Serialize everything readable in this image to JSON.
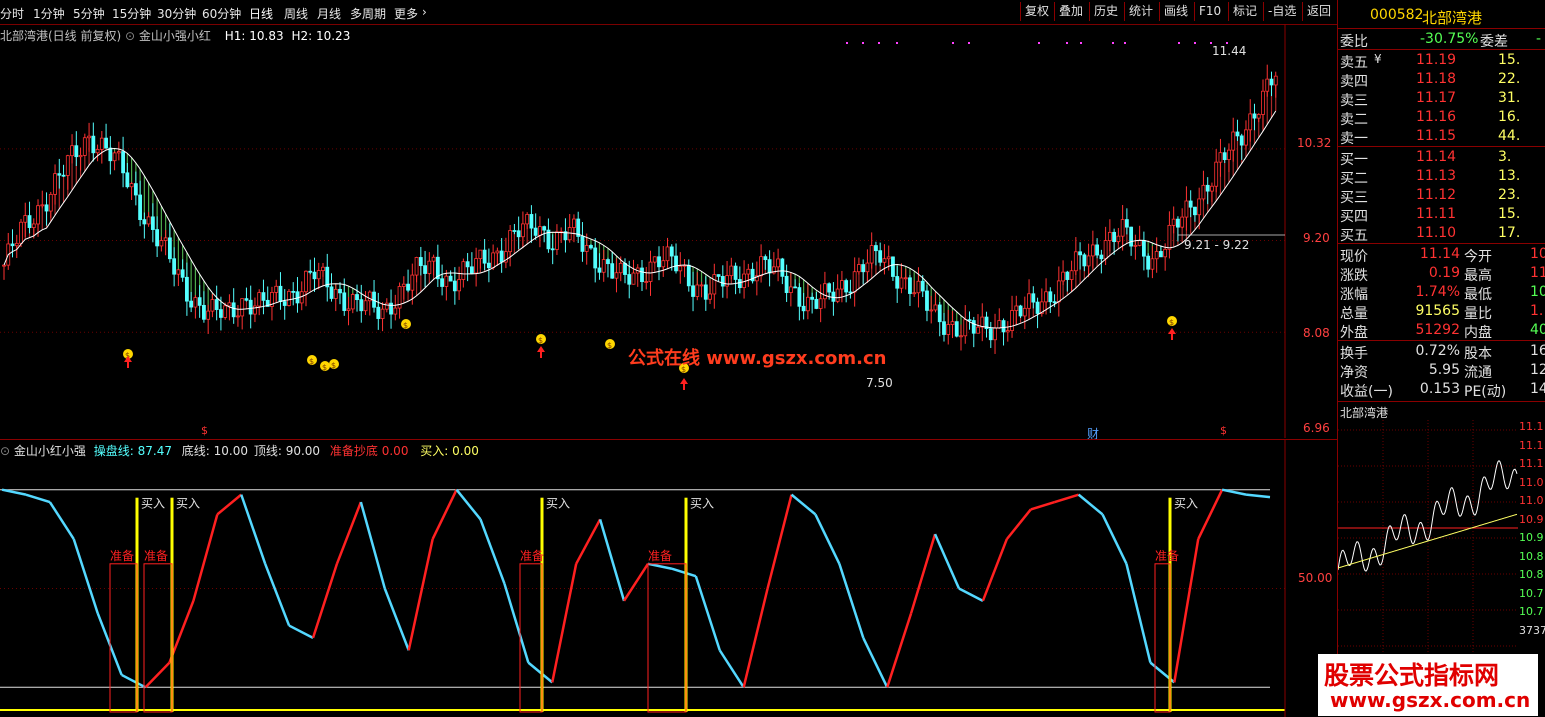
{
  "toolbar": {
    "periods": [
      "分时",
      "1分钟",
      "5分钟",
      "15分钟",
      "30分钟",
      "60分钟",
      "日线",
      "周线",
      "月线",
      "多周期",
      "更多"
    ],
    "active_period": "日线",
    "buttons": [
      "复权",
      "叠加",
      "历史",
      "统计",
      "画线",
      "F10",
      "标记",
      "-自选",
      "返回"
    ]
  },
  "main_chart": {
    "title": "北部湾港(日线 前复权)",
    "indicator": "金山小强小红",
    "h1": "H1: 10.83",
    "h2": "H2: 10.23",
    "y_labels": [
      "10.32",
      "9.20",
      "8.08",
      "6.96"
    ],
    "annot_high": "11.44",
    "annot_low": "7.50",
    "annot_range": "9.21 - 9.22",
    "watermark": "公式在线  www.gszx.com.cn",
    "marker_cai": "财"
  },
  "indicator_chart": {
    "name": "金山小红小强",
    "v1_label": "操盘线:",
    "v1": "87.47",
    "v2": "底线: 10.00",
    "v3": "顶线: 90.00",
    "v4_label": "准备抄底",
    "v4": "0.00",
    "v5": "买入: 0.00",
    "y_label": "50.00",
    "buy_text": "买入",
    "prepare_text": "准备"
  },
  "quote": {
    "code": "000582",
    "name": "北部湾港",
    "weibi_label": "委比",
    "weibi": "-30.75%",
    "weicha_label": "委差",
    "weicha": "-",
    "asks": [
      {
        "label": "卖五",
        "flag": "¥",
        "price": "11.19",
        "vol": "15."
      },
      {
        "label": "卖四",
        "flag": "",
        "price": "11.18",
        "vol": "22."
      },
      {
        "label": "卖三",
        "flag": "",
        "price": "11.17",
        "vol": "31."
      },
      {
        "label": "卖二",
        "flag": "",
        "price": "11.16",
        "vol": "16."
      },
      {
        "label": "卖一",
        "flag": "",
        "price": "11.15",
        "vol": "44."
      }
    ],
    "bids": [
      {
        "label": "买一",
        "price": "11.14",
        "vol": "3."
      },
      {
        "label": "买二",
        "price": "11.13",
        "vol": "13."
      },
      {
        "label": "买三",
        "price": "11.12",
        "vol": "23."
      },
      {
        "label": "买四",
        "price": "11.11",
        "vol": "15."
      },
      {
        "label": "买五",
        "price": "11.10",
        "vol": "17."
      }
    ],
    "stats": [
      {
        "l1": "现价",
        "v1": "11.14",
        "l2": "今开",
        "v2": "10"
      },
      {
        "l1": "涨跌",
        "v1": "0.19",
        "l2": "最高",
        "v2": "11"
      },
      {
        "l1": "涨幅",
        "v1": "1.74%",
        "l2": "最低",
        "v2": "10"
      },
      {
        "l1": "总量",
        "v1": "91565",
        "l2": "量比",
        "v2": "1."
      },
      {
        "l1": "外盘",
        "v1": "51292",
        "l2": "内盘",
        "v2": "40"
      }
    ],
    "stats2": [
      {
        "l1": "换手",
        "v1": "0.72%",
        "l2": "股本",
        "v2": "16."
      },
      {
        "l1": "净资",
        "v1": "5.95",
        "l2": "流通",
        "v2": "12."
      },
      {
        "l1": "收益(一)",
        "v1": "0.153",
        "l2": "PE(动)",
        "v2": "14"
      }
    ],
    "intraday_title": "北部湾港",
    "intraday_axis": [
      "11.1",
      "11.1",
      "11.1",
      "11.0",
      "11.0",
      "10.9",
      "10.9",
      "10.8",
      "10.8",
      "10.7",
      "10.7",
      "3737"
    ],
    "logo_line1": "股票公式指标网",
    "logo_line2": "www.gszx.com.cn"
  },
  "colors": {
    "up": "#ff3232",
    "down": "#54ffff",
    "bg": "#000000",
    "grid": "#8a0000",
    "label": "#ff0000",
    "yellow": "#ffff00"
  },
  "chart_data": {
    "type": "line",
    "series": [
      {
        "name": "K线 收盘",
        "values": [
          8.9,
          9.3,
          9.6,
          9.9,
          10.2,
          10.5,
          10.3,
          10.0,
          9.6,
          9.2,
          8.8,
          8.5,
          8.3,
          8.3,
          8.5,
          8.4,
          8.5,
          8.6,
          8.8,
          8.6,
          8.5,
          8.4,
          8.3,
          8.6,
          8.8,
          8.9,
          8.7,
          8.8,
          9.0,
          9.1,
          9.3,
          9.4,
          9.2,
          9.3,
          9.1,
          8.9,
          8.7,
          8.8,
          9.0,
          8.9,
          8.7,
          8.6,
          8.7,
          8.8,
          8.9,
          8.8,
          8.6,
          8.4,
          8.5,
          8.7,
          8.9,
          9.0,
          8.8,
          8.6,
          8.3,
          8.2,
          8.1,
          8.1,
          8.2,
          8.3,
          8.4,
          8.6,
          8.8,
          9.0,
          9.2,
          9.3,
          9.1,
          9.0,
          9.3,
          9.6,
          9.9,
          10.2,
          10.5,
          10.9,
          11.2
        ]
      },
      {
        "name": "操盘线",
        "values": [
          90,
          88,
          85,
          70,
          40,
          15,
          10,
          20,
          45,
          80,
          88,
          60,
          35,
          30,
          60,
          85,
          50,
          25,
          70,
          90,
          78,
          52,
          20,
          12,
          60,
          78,
          45,
          60,
          58,
          55,
          25,
          10,
          50,
          88,
          80,
          60,
          30,
          10,
          40,
          72,
          50,
          45,
          70,
          82,
          85,
          88,
          80,
          60,
          20,
          12,
          70,
          90,
          88,
          87
        ]
      }
    ]
  }
}
